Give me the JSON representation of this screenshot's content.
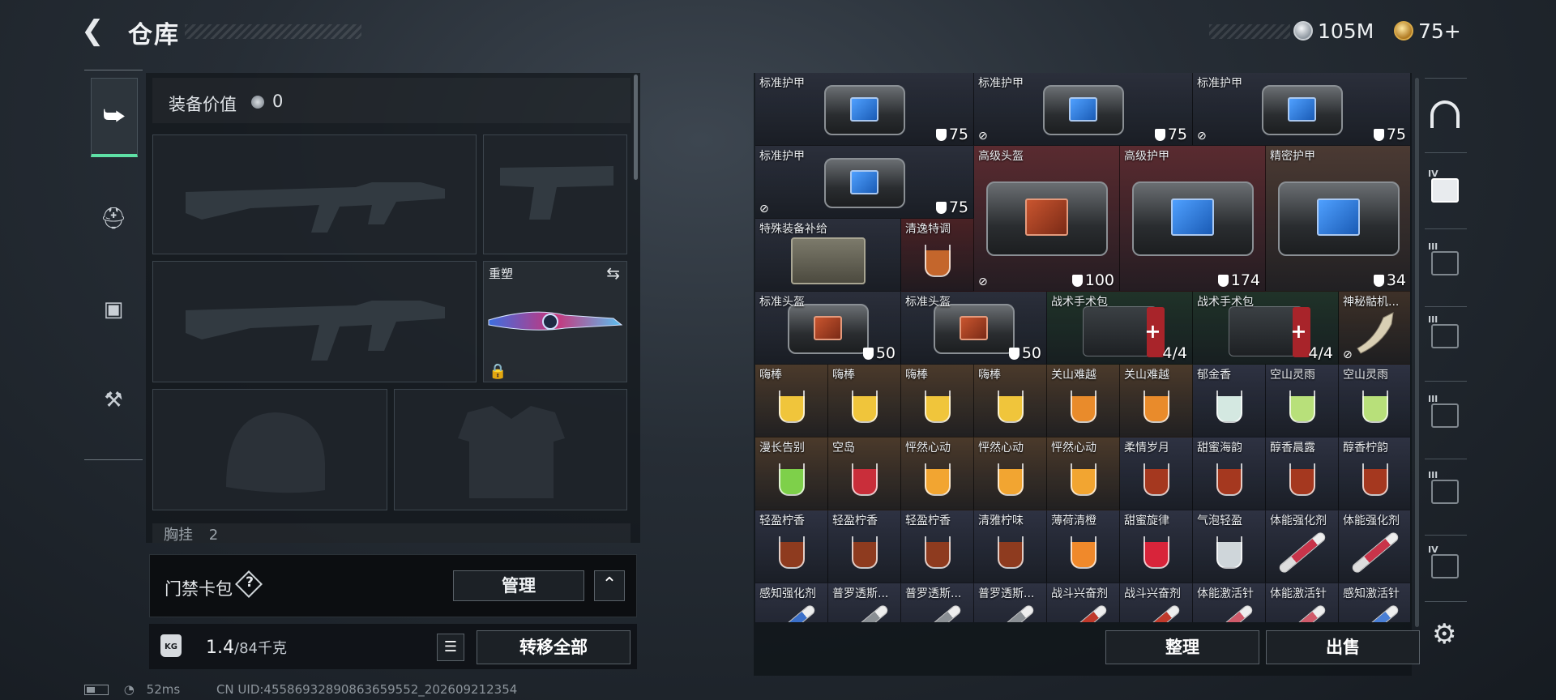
{
  "header": {
    "back_icon": "back-arrow-icon",
    "title": "仓库"
  },
  "currency": [
    {
      "name": "silver",
      "icon": "silver-coin-icon",
      "value": "105M"
    },
    {
      "name": "gold",
      "icon": "gold-coin-icon",
      "value": "75+"
    }
  ],
  "categories": [
    {
      "icon": "pistol-icon",
      "symbol": "⭢"
    },
    {
      "icon": "helmet-icon",
      "symbol": "⛑"
    },
    {
      "icon": "backpack-icon",
      "symbol": "▣"
    },
    {
      "icon": "toolbox-icon",
      "symbol": "⚒"
    }
  ],
  "equipment": {
    "value_label": "装备价值",
    "value": "0",
    "melee_label": "重塑",
    "chest_label": "胸挂",
    "chest_count": "2"
  },
  "access_card": {
    "label": "门禁卡包",
    "help": "?",
    "manage": "管理",
    "collapse": "^"
  },
  "weight": {
    "icon": "KG",
    "current": "1.4",
    "max": "/84千克",
    "transfer": "转移全部"
  },
  "status": {
    "ping": "52ms",
    "uid": "CN UID:45586932890863659552_202609212354"
  },
  "grid": [
    {
      "name": "标准护甲",
      "badge": "75",
      "type": "bag",
      "color": "#2b2f3b"
    },
    {
      "name": "标准护甲",
      "badge": "75",
      "type": "bag",
      "color": "#2b2f3b",
      "broken": true
    },
    {
      "name": "标准护甲",
      "badge": "75",
      "type": "bag",
      "color": "#2b2f3b",
      "broken": true
    },
    {
      "name": "标准护甲",
      "badge": "75",
      "type": "bag",
      "color": "#2b2f3b",
      "broken": true
    },
    {
      "name": "高级头盔",
      "badge": "100",
      "type": "bag-red",
      "color": "#5a2b30",
      "broken": true
    },
    {
      "name": "高级护甲",
      "badge": "174",
      "type": "bag",
      "color": "#5a2b30"
    },
    {
      "name": "精密护甲",
      "badge": "34",
      "type": "bag",
      "color": "#4b3a33"
    },
    {
      "name": "特殊装备补给",
      "type": "crate",
      "color": "#2b2f3b"
    },
    {
      "name": "清逸特调",
      "type": "drink",
      "color": "#4a2225",
      "drink": "#c4662c"
    },
    {
      "name": "标准头盔",
      "badge": "50",
      "type": "bag-red",
      "color": "#2b2f3b"
    },
    {
      "name": "标准头盔",
      "badge": "50",
      "type": "bag-red",
      "color": "#2b2f3b"
    },
    {
      "name": "战术手术包",
      "badge": "4/4",
      "type": "medkit",
      "color": "#203329"
    },
    {
      "name": "战术手术包",
      "badge": "4/4",
      "type": "medkit",
      "color": "#203329"
    },
    {
      "name": "神秘骷机...",
      "type": "horn",
      "color": "#3e3128",
      "broken": true
    },
    {
      "name": "嗨棒",
      "type": "drink",
      "color": "#4b3a2b",
      "drink": "#f0c53b"
    },
    {
      "name": "嗨棒",
      "type": "drink",
      "color": "#4b3a2b",
      "drink": "#f0c53b"
    },
    {
      "name": "嗨棒",
      "type": "drink",
      "color": "#4b3a2b",
      "drink": "#f0c53b"
    },
    {
      "name": "嗨棒",
      "type": "drink",
      "color": "#4b3a2b",
      "drink": "#f0c53b"
    },
    {
      "name": "关山难越",
      "type": "drink",
      "color": "#4b3a2b",
      "drink": "#e98b2b"
    },
    {
      "name": "关山难越",
      "type": "drink",
      "color": "#4b3a2b",
      "drink": "#e98b2b"
    },
    {
      "name": "郁金香",
      "type": "drink",
      "color": "#2e3242",
      "drink": "#d4e8e1"
    },
    {
      "name": "空山灵雨",
      "type": "drink",
      "color": "#2e3242",
      "drink": "#b8e07a"
    },
    {
      "name": "空山灵雨",
      "type": "drink",
      "color": "#2e3242",
      "drink": "#b8e07a"
    },
    {
      "name": "漫长告别",
      "type": "drink",
      "color": "#4b3a2b",
      "drink": "#7ed04a"
    },
    {
      "name": "空岛",
      "type": "drink",
      "color": "#4b3a2b",
      "drink": "#c92e3a"
    },
    {
      "name": "怦然心动",
      "type": "drink",
      "color": "#4b3a2b",
      "drink": "#f2a531"
    },
    {
      "name": "怦然心动",
      "type": "drink",
      "color": "#4b3a2b",
      "drink": "#f2a531"
    },
    {
      "name": "怦然心动",
      "type": "drink",
      "color": "#4b3a2b",
      "drink": "#f2a531"
    },
    {
      "name": "柔情岁月",
      "type": "drink",
      "color": "#2e3242",
      "drink": "#a5381f"
    },
    {
      "name": "甜蜜海韵",
      "type": "drink",
      "color": "#2e3242",
      "drink": "#a5381f"
    },
    {
      "name": "醇香晨露",
      "type": "drink",
      "color": "#2e3242",
      "drink": "#a5381f"
    },
    {
      "name": "醇香柠韵",
      "type": "drink",
      "color": "#2e3242",
      "drink": "#a5381f"
    },
    {
      "name": "轻盈柠香",
      "type": "drink",
      "color": "#2e3242",
      "drink": "#8e3b1f"
    },
    {
      "name": "轻盈柠香",
      "type": "drink",
      "color": "#2e3242",
      "drink": "#8e3b1f"
    },
    {
      "name": "轻盈柠香",
      "type": "drink",
      "color": "#2e3242",
      "drink": "#8e3b1f"
    },
    {
      "name": "清雅柠味",
      "type": "drink",
      "color": "#2e3242",
      "drink": "#8e3b1f"
    },
    {
      "name": "薄荷清橙",
      "type": "drink",
      "color": "#2e3242",
      "drink": "#f0892b"
    },
    {
      "name": "甜蜜旋律",
      "type": "drink",
      "color": "#2e3242",
      "drink": "#d8243a"
    },
    {
      "name": "气泡轻盈",
      "type": "drink",
      "color": "#2e3242",
      "drink": "#cfd6da"
    },
    {
      "name": "体能强化剂",
      "type": "injector",
      "color": "#2e3242",
      "drink": "#c9344a"
    },
    {
      "name": "体能强化剂",
      "type": "injector",
      "color": "#2e3242",
      "drink": "#c9344a"
    },
    {
      "name": "感知强化剂",
      "type": "injector",
      "color": "#2e3242",
      "drink": "#3a6fc9"
    },
    {
      "name": "普罗透斯...",
      "type": "syringe",
      "color": "#2e3242",
      "drink": "#8a8f94"
    },
    {
      "name": "普罗透斯...",
      "type": "syringe",
      "color": "#2e3242",
      "drink": "#8a8f94"
    },
    {
      "name": "普罗透斯...",
      "type": "syringe",
      "color": "#2e3242",
      "drink": "#8a8f94"
    },
    {
      "name": "战斗兴奋剂",
      "type": "injector",
      "color": "#2e3242",
      "drink": "#c0392b"
    },
    {
      "name": "战斗兴奋剂",
      "type": "injector",
      "color": "#2e3242",
      "drink": "#c0392b"
    },
    {
      "name": "体能激活针",
      "type": "injector",
      "color": "#2e3242",
      "drink": "#d05a6a"
    },
    {
      "name": "体能激活针",
      "type": "injector",
      "color": "#2e3242",
      "drink": "#d05a6a"
    },
    {
      "name": "感知激活针",
      "type": "injector",
      "color": "#2e3242",
      "drink": "#4a7fd6"
    }
  ],
  "actions": {
    "sort": "整理",
    "sell": "出售"
  },
  "right_tabs": [
    {
      "icon": "arch-icon",
      "label": ""
    },
    {
      "icon": "medkit-case-icon",
      "label": "IV"
    },
    {
      "icon": "case-icon",
      "label": "III"
    },
    {
      "icon": "case-icon",
      "label": "III"
    },
    {
      "icon": "case-icon",
      "label": "III"
    },
    {
      "icon": "case-icon",
      "label": "III"
    },
    {
      "icon": "case-icon",
      "label": "IV"
    }
  ],
  "settings_icon": "gear-icon"
}
